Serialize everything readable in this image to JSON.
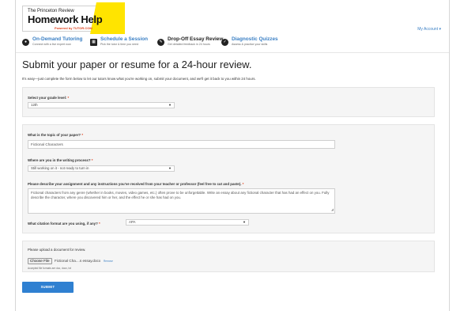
{
  "header": {
    "logo_top": "The Princeton Review",
    "logo_main": "Homework Help",
    "logo_powered": "Powered by",
    "logo_partner": "TUTOR.COM",
    "account_label": "My Account ▾"
  },
  "nav": [
    {
      "icon": "chat-icon",
      "title": "On-Demand Tutoring",
      "subtitle": "Connect with a live expert now"
    },
    {
      "icon": "calendar-icon",
      "title": "Schedule a Session",
      "subtitle": "Pick the tutor & time you need"
    },
    {
      "icon": "essay-icon",
      "title": "Drop-Off Essay Review",
      "subtitle": "Get detailed feedback in 24 hours"
    },
    {
      "icon": "quiz-icon",
      "title": "Diagnostic Quizzes",
      "subtitle": "Assess & practice your skills"
    }
  ],
  "page": {
    "title": "Submit your paper or resume for a 24-hour review.",
    "intro": "It's easy—just complete the form below to let our tutors know what you're working on, submit your document, and we'll get it back to you within 24 hours."
  },
  "form": {
    "grade_label": "Select your grade level:",
    "grade_value": "12th",
    "topic_label": "What is the topic of your paper?",
    "topic_value": "Fictional Characters",
    "process_label": "Where are you in the writing process?",
    "process_value": "Still working on it - not ready to turn in",
    "describe_label": "Please describe your assignment and any instructions you've received from your teacher or professor (feel free to cut and paste).",
    "describe_value": "Fictional characters from any genre (whether in books, movies, video games, etc.) often prove to be unforgettable. Write an essay about any fictional character that has had an effect on you. Fully describe the character, where you discovered him or her, and the effect he or she has had on you.",
    "citation_label": "What citation format are you using, if any?",
    "citation_value": "APA",
    "upload_label": "Please upload a document for review.",
    "file_button": "Choose File",
    "file_name": "Fictional Cha....s essay.docx",
    "file_remove": "Remove",
    "file_note": "Accepted file formats are doc, docx, txt",
    "required_mark": "*",
    "submit_label": "SUBMIT"
  },
  "colors": {
    "link": "#3a7fc4",
    "submit": "#2f80d1",
    "logo_yellow": "#ffe400",
    "required": "#e0401a"
  }
}
